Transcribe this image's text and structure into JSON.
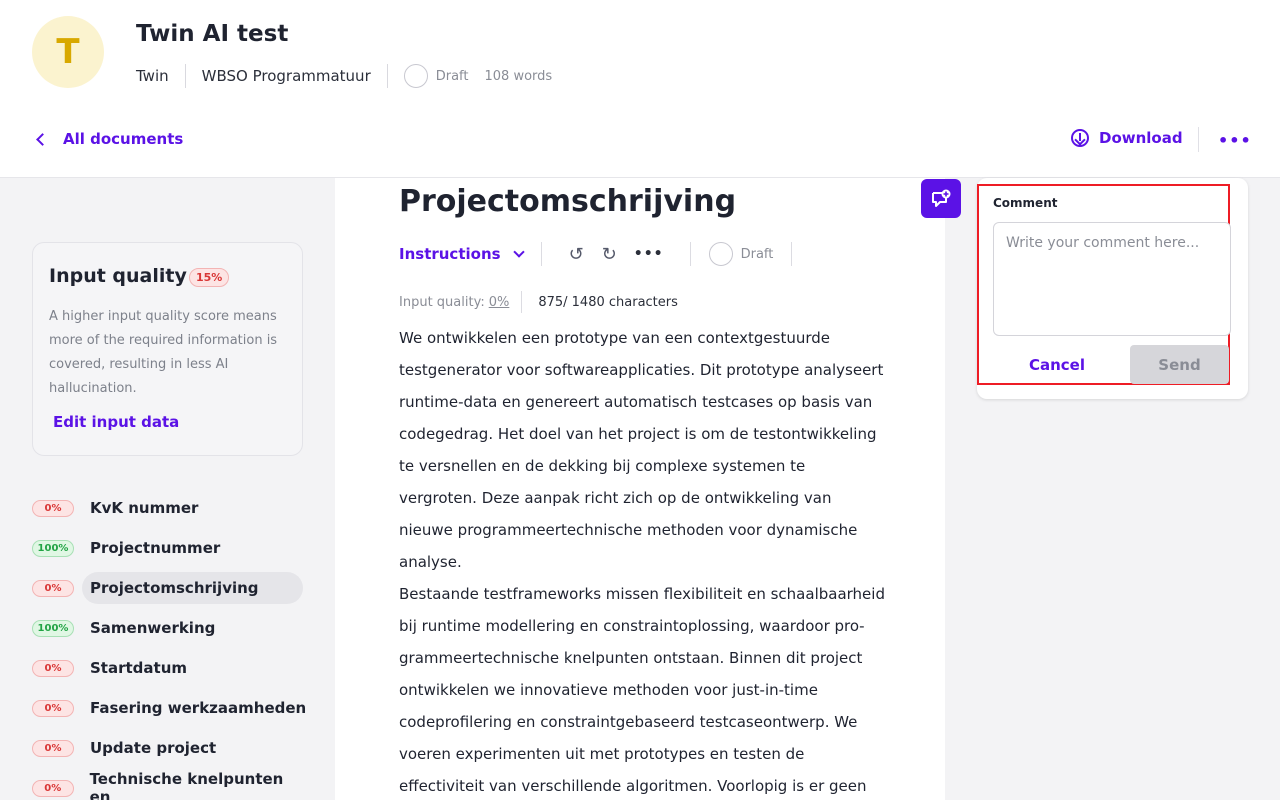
{
  "header": {
    "avatar_letter": "T",
    "title": "Twin AI test",
    "company": "Twin",
    "program": "WBSO Programmatuur",
    "status": "Draft",
    "word_count": "108 words",
    "back_label": "All documents",
    "download_label": "Download",
    "more_label": "•••"
  },
  "sidebar": {
    "input_quality": {
      "title": "Input quality",
      "score": "15%",
      "description": "A higher input quality score means more of the required information is covered, resulting in less AI hallucination.",
      "edit_label": "Edit input data"
    },
    "items": [
      {
        "label": "KvK nummer",
        "score": "0%",
        "status": "red"
      },
      {
        "label": "Projectnummer",
        "score": "100%",
        "status": "green"
      },
      {
        "label": "Projectomschrijving",
        "score": "0%",
        "status": "red",
        "active": true
      },
      {
        "label": "Samenwerking",
        "score": "100%",
        "status": "green"
      },
      {
        "label": "Startdatum",
        "score": "0%",
        "status": "red"
      },
      {
        "label": "Fasering werkzaamheden",
        "score": "0%",
        "status": "red"
      },
      {
        "label": "Update project",
        "score": "0%",
        "status": "red"
      },
      {
        "label": "Technische knelpunten en",
        "score": "0%",
        "status": "red"
      }
    ]
  },
  "main": {
    "section_title": "Projectomschrijving",
    "instructions_label": "Instructions",
    "undo_icon": "undo-icon",
    "redo_icon": "redo-icon",
    "more_label": "•••",
    "status": "Draft",
    "quality_label": "Input quality:",
    "quality_value": "0%",
    "chars": "875/ 1480 characters",
    "paragraphs": [
      "We ontwikkelen een prototype van een contextgestuurde testge­nerator voor softwareapplicaties. Dit prototype analyseert run­time-data en genereert automatisch testcases op basis van code­gedrag. Het doel van het project is om de testontwikkeling te ver­snellen en de dekking bij complexe systemen te vergroten. Deze aanpak richt zich op de ontwikkeling van nieuwe programmeer­technische methoden voor dynamische analyse.",
      "Bestaande testframeworks missen flexibiliteit en schaalbaarheid bij runtime modellering en constraintoplossing, waardoor pro­grammeertechnische knelpunten ontstaan. Binnen dit project ont­wikkelen we innovatieve methoden voor just-in-time codeprofile­ring en constraintgebaseerd testcaseontwerp. We voeren experi­menten uit met prototypes en testen de effectiviteit van verschil­lende algoritmen. Voorlopig is er geen eerdere WBSO-aanvraag ge­weest voor dit project."
    ]
  },
  "comment": {
    "label": "Comment",
    "placeholder": "Write your comment here...",
    "cancel_label": "Cancel",
    "send_label": "Send"
  },
  "colors": {
    "accent": "#5b12e6",
    "highlight": "#ee1c25"
  }
}
